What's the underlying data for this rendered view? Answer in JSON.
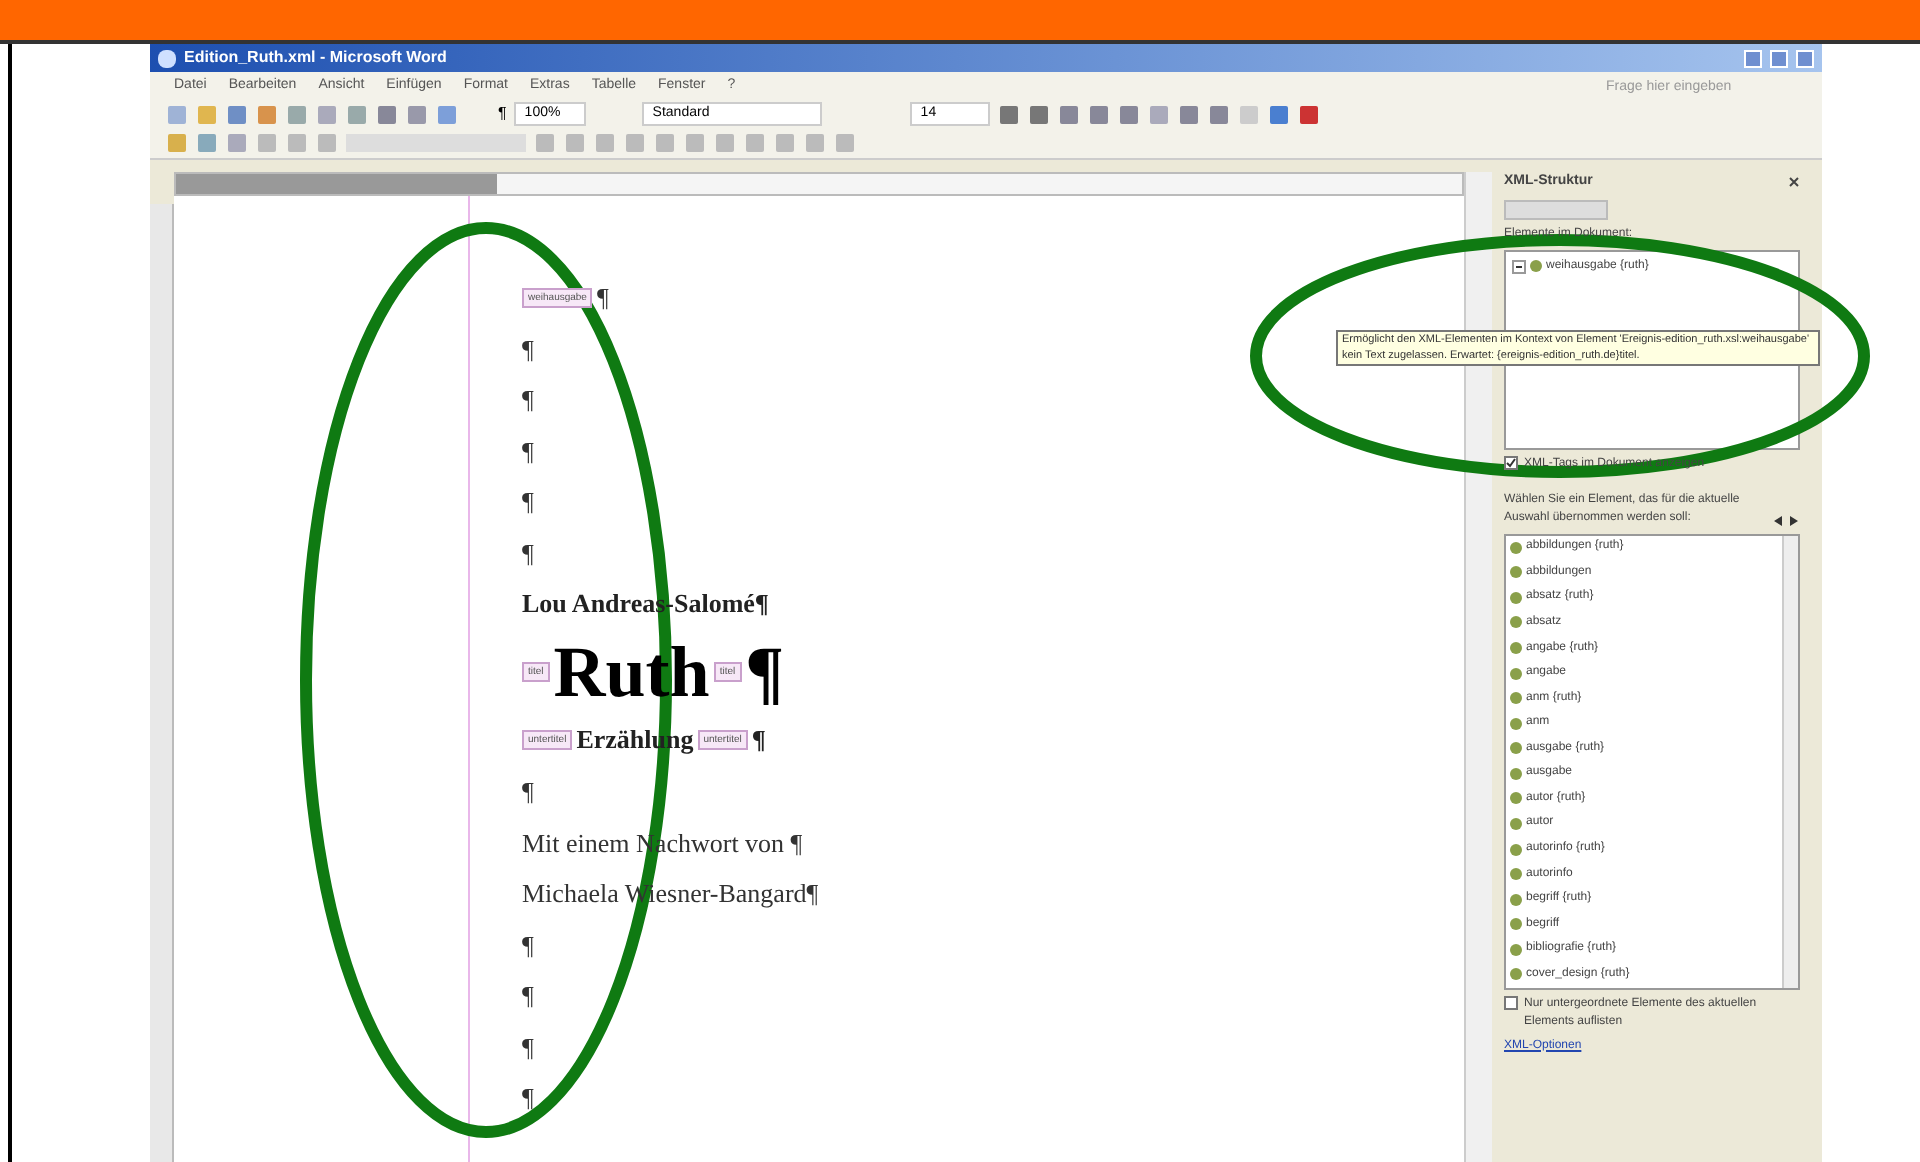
{
  "window": {
    "title": "Edition_Ruth.xml - Microsoft Word"
  },
  "menu": [
    "Datei",
    "Bearbeiten",
    "Ansicht",
    "Einfügen",
    "Format",
    "Extras",
    "Tabelle",
    "Fenster",
    "?"
  ],
  "help_box": {
    "placeholder": "Frage hier eingeben"
  },
  "toolbar": {
    "marks_button": "¶",
    "zoom": "100%",
    "style": "Standard",
    "font_size": "14"
  },
  "document": {
    "lines": [
      {
        "parts": [
          {
            "kind": "tag",
            "text": "weihausgabe"
          },
          {
            "kind": "text",
            "text": "¶"
          }
        ]
      },
      {
        "parts": [
          {
            "kind": "text",
            "text": "¶"
          }
        ]
      },
      {
        "parts": [
          {
            "kind": "text",
            "text": "¶"
          }
        ]
      },
      {
        "parts": [
          {
            "kind": "text",
            "text": "¶"
          }
        ]
      },
      {
        "parts": [
          {
            "kind": "text",
            "text": "¶"
          }
        ]
      },
      {
        "parts": [
          {
            "kind": "text",
            "text": "¶"
          }
        ]
      },
      {
        "parts": [
          {
            "kind": "text",
            "text": "Lou Andreas-Salomé¶"
          }
        ]
      },
      {
        "parts": [
          {
            "kind": "tag",
            "text": "titel"
          },
          {
            "kind": "text",
            "text": "Ruth"
          },
          {
            "kind": "tag",
            "text": "titel"
          },
          {
            "kind": "text",
            "text": "¶"
          }
        ]
      },
      {
        "parts": [
          {
            "kind": "tag",
            "text": "untertitel"
          },
          {
            "kind": "text",
            "text": "Erzählung"
          },
          {
            "kind": "tag",
            "text": "untertitel"
          },
          {
            "kind": "text",
            "text": "¶"
          }
        ]
      },
      {
        "parts": [
          {
            "kind": "text",
            "text": "¶"
          }
        ]
      },
      {
        "parts": [
          {
            "kind": "text",
            "text": "Mit einem Nachwort von ¶"
          }
        ]
      },
      {
        "parts": [
          {
            "kind": "text",
            "text": "Michaela Wiesner-Bangard¶"
          }
        ]
      },
      {
        "parts": [
          {
            "kind": "text",
            "text": "¶"
          }
        ]
      },
      {
        "parts": [
          {
            "kind": "text",
            "text": "¶"
          }
        ]
      },
      {
        "parts": [
          {
            "kind": "text",
            "text": "¶"
          }
        ]
      },
      {
        "parts": [
          {
            "kind": "text",
            "text": "¶"
          }
        ]
      }
    ]
  },
  "task_pane": {
    "title": "XML-Struktur",
    "elements_label": "Elemente im Dokument:",
    "tree": [
      {
        "label": "weihausgabe {ruth}",
        "expanded": true
      }
    ],
    "tooltip": "Ermöglicht den XML-Elementen im Kontext von Element 'Ereignis-edition_ruth.xsl:weihausgabe' kein Text zugelassen. Erwartet: {ereignis-edition_ruth.de}titel.",
    "show_tags": {
      "label": "XML-Tags im Dokument anzeigen",
      "checked": true
    },
    "choose_label": "Wählen Sie ein Element, das für die aktuelle Auswahl übernommen werden soll:",
    "elements": [
      "abbildungen {ruth}",
      "abbildungen",
      "absatz {ruth}",
      "absatz",
      "angabe {ruth}",
      "angabe",
      "anm {ruth}",
      "anm",
      "ausgabe {ruth}",
      "ausgabe",
      "autor {ruth}",
      "autor",
      "autorinfo {ruth}",
      "autorinfo",
      "begriff {ruth}",
      "begriff",
      "bibliografie {ruth}",
      "cover_design {ruth}"
    ],
    "children_only": {
      "label": "Nur untergeordnete Elemente des aktuellen Elements auflisten",
      "checked": false
    },
    "options_link": "XML-Optionen"
  }
}
